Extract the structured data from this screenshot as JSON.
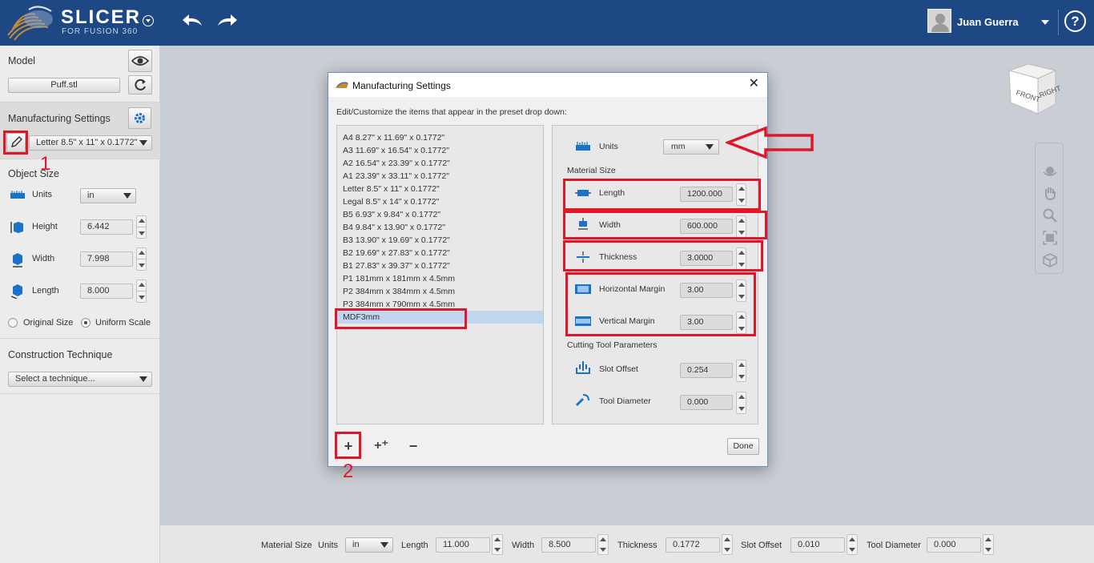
{
  "app": {
    "title": "SLICER",
    "subtitle": "FOR FUSION 360",
    "user_name": "Juan Guerra",
    "help_label": "?"
  },
  "left_panel": {
    "model_title": "Model",
    "model_file": "Puff.stl",
    "mfg_title": "Manufacturing Settings",
    "mfg_preset": "Letter 8.5\" x 11\" x 0.1772\"",
    "object_size_title": "Object Size",
    "units_label": "Units",
    "units_value": "in",
    "height_label": "Height",
    "height_value": "6.442",
    "width_label": "Width",
    "width_value": "7.998",
    "length_label": "Length",
    "length_value": "8.000",
    "original_size_label": "Original Size",
    "uniform_scale_label": "Uniform Scale",
    "construction_title": "Construction Technique",
    "technique_placeholder": "Select a technique..."
  },
  "annotations": {
    "marker_1": "1",
    "marker_2": "2",
    "color": "#e2162a"
  },
  "dialog": {
    "title": "Manufacturing Settings",
    "close": "✕",
    "instruction": "Edit/Customize the items that appear in the preset drop down:",
    "presets": [
      "A4 8.27\" x 11.69\" x 0.1772\"",
      "A3 11.69\" x 16.54\" x 0.1772\"",
      "A2 16.54\" x 23.39\" x 0.1772\"",
      "A1 23.39\" x 33.11\" x 0.1772\"",
      "Letter 8.5\" x 11\" x 0.1772\"",
      "Legal 8.5\" x 14\" x 0.1772\"",
      "B5 6.93\" x 9.84\" x 0.1772\"",
      "B4 9.84\" x 13.90\" x 0.1772\"",
      "B3 13.90\" x 19.69\" x 0.1772\"",
      "B2 19.69\" x 27.83\" x 0.1772\"",
      "B1 27.83\" x 39.37\" x 0.1772\"",
      "P1 181mm x 181mm x 4.5mm",
      "P2 384mm x 384mm x 4.5mm",
      "P3 384mm x 790mm x 4.5mm",
      "MDF3mm"
    ],
    "selected_preset": "MDF3mm",
    "units_label": "Units",
    "units_value": "mm",
    "material_size_title": "Material Size",
    "length_label": "Length",
    "length_value": "1200.000",
    "width_label": "Width",
    "width_value": "600.000",
    "thickness_label": "Thickness",
    "thickness_value": "3.0000",
    "hmargin_label": "Horizontal Margin",
    "hmargin_value": "3.00",
    "vmargin_label": "Vertical Margin",
    "vmargin_value": "3.00",
    "cutting_title": "Cutting Tool Parameters",
    "slot_offset_label": "Slot Offset",
    "slot_offset_value": "0.254",
    "tool_diameter_label": "Tool Diameter",
    "tool_diameter_value": "0.000",
    "add_label": "+",
    "add_copy_label": "+⁺",
    "remove_label": "−",
    "done_label": "Done"
  },
  "view_cube": {
    "front": "FRONT",
    "right": "RIGHT"
  },
  "bottom_bar": {
    "material_size_label": "Material Size",
    "units_label": "Units",
    "units_value": "in",
    "length_label": "Length",
    "length_value": "11.000",
    "width_label": "Width",
    "width_value": "8.500",
    "thickness_label": "Thickness",
    "thickness_value": "0.1772",
    "slot_offset_label": "Slot Offset",
    "slot_offset_value": "0.010",
    "tool_diameter_label": "Tool Diameter",
    "tool_diameter_value": "0.000"
  },
  "colors": {
    "topbar": "#1d4883",
    "panel": "#ececec",
    "viewport": "#c9ced4",
    "accent_blue": "#1a73c8",
    "selection": "#c1d6ee"
  }
}
